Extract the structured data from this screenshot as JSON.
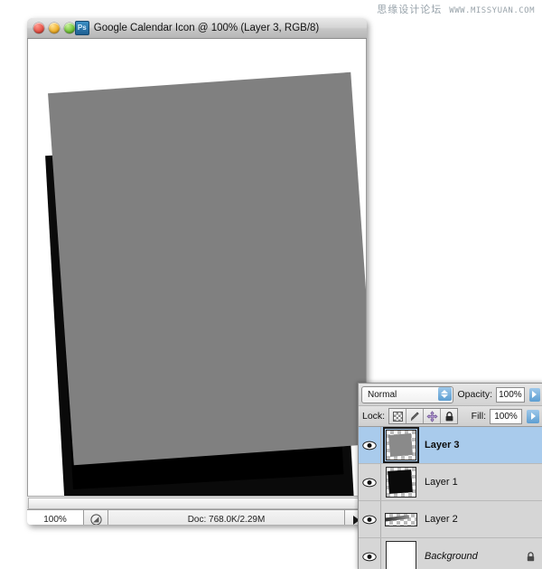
{
  "watermark": {
    "cn_text": "思缘设计论坛",
    "url_text": "WWW.MISSYUAN.COM"
  },
  "document_window": {
    "app_badge": "Ps",
    "title": "Google Calendar Icon @ 100% (Layer 3, RGB/8)",
    "traffic_lights": {
      "close": "close-button",
      "minimize": "minimize-button",
      "zoom": "zoom-button"
    },
    "status_bar": {
      "zoom_level": "100%",
      "doc_info": "Doc: 768.0K/2.29M",
      "thumbnail_icon": "document-preview-icon",
      "menu_arrow": "status-menu-arrow"
    }
  },
  "canvas": {
    "artwork_gray_color": "#808080",
    "artwork_black_color": "#000000",
    "background_color": "#ffffff"
  },
  "layers_panel": {
    "blend_mode": "Normal",
    "opacity_label": "Opacity:",
    "opacity_value": "100%",
    "lock_label": "Lock:",
    "lock_buttons": [
      "lock-transparent-pixels",
      "lock-image-pixels",
      "lock-position",
      "lock-all"
    ],
    "fill_label": "Fill:",
    "fill_value": "100%",
    "layers": [
      {
        "name": "Layer 3",
        "visible": true,
        "selected": true,
        "locked": false,
        "thumb": "gray-rotated-square"
      },
      {
        "name": "Layer 1",
        "visible": true,
        "selected": false,
        "locked": false,
        "thumb": "black-rotated-square"
      },
      {
        "name": "Layer 2",
        "visible": true,
        "selected": false,
        "locked": false,
        "thumb": "diagonal-streak"
      },
      {
        "name": "Background",
        "visible": true,
        "selected": false,
        "locked": true,
        "thumb": "white-fill"
      }
    ],
    "selection_color": "#a9cbec"
  }
}
